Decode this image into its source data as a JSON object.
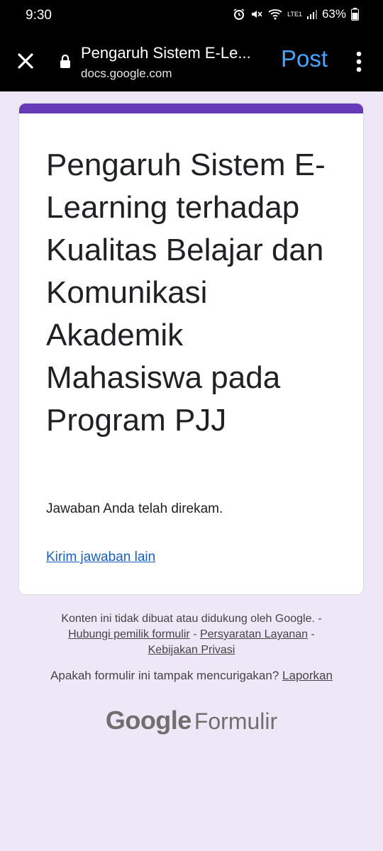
{
  "status_bar": {
    "time": "9:30",
    "battery": "63%",
    "network_label": "LTE1"
  },
  "browser": {
    "title": "Pengaruh Sistem E-Le...",
    "url": "docs.google.com",
    "action_label": "Post",
    "icons": [
      "close-icon",
      "lock-icon",
      "more-vertical-icon"
    ]
  },
  "form": {
    "accent_color": "#673ab7",
    "title": "Pengaruh Sistem E-Learning terhadap Kualitas Belajar dan Komunikasi Akademik Mahasiswa pada Program PJJ",
    "confirmation": "Jawaban Anda telah direkam.",
    "submit_another": "Kirim jawaban lain"
  },
  "footer": {
    "disclaimer": "Konten ini tidak dibuat atau didukung oleh Google. -",
    "contact_owner": "Hubungi pemilik formulir",
    "sep1": " - ",
    "terms": "Persyaratan Layanan",
    "sep2": " -",
    "privacy": "Kebijakan Privasi",
    "suspicious_question": "Apakah formulir ini tampak mencurigakan?",
    "report": "Laporkan"
  },
  "brand": {
    "google": "Google",
    "product": "Formulir"
  }
}
